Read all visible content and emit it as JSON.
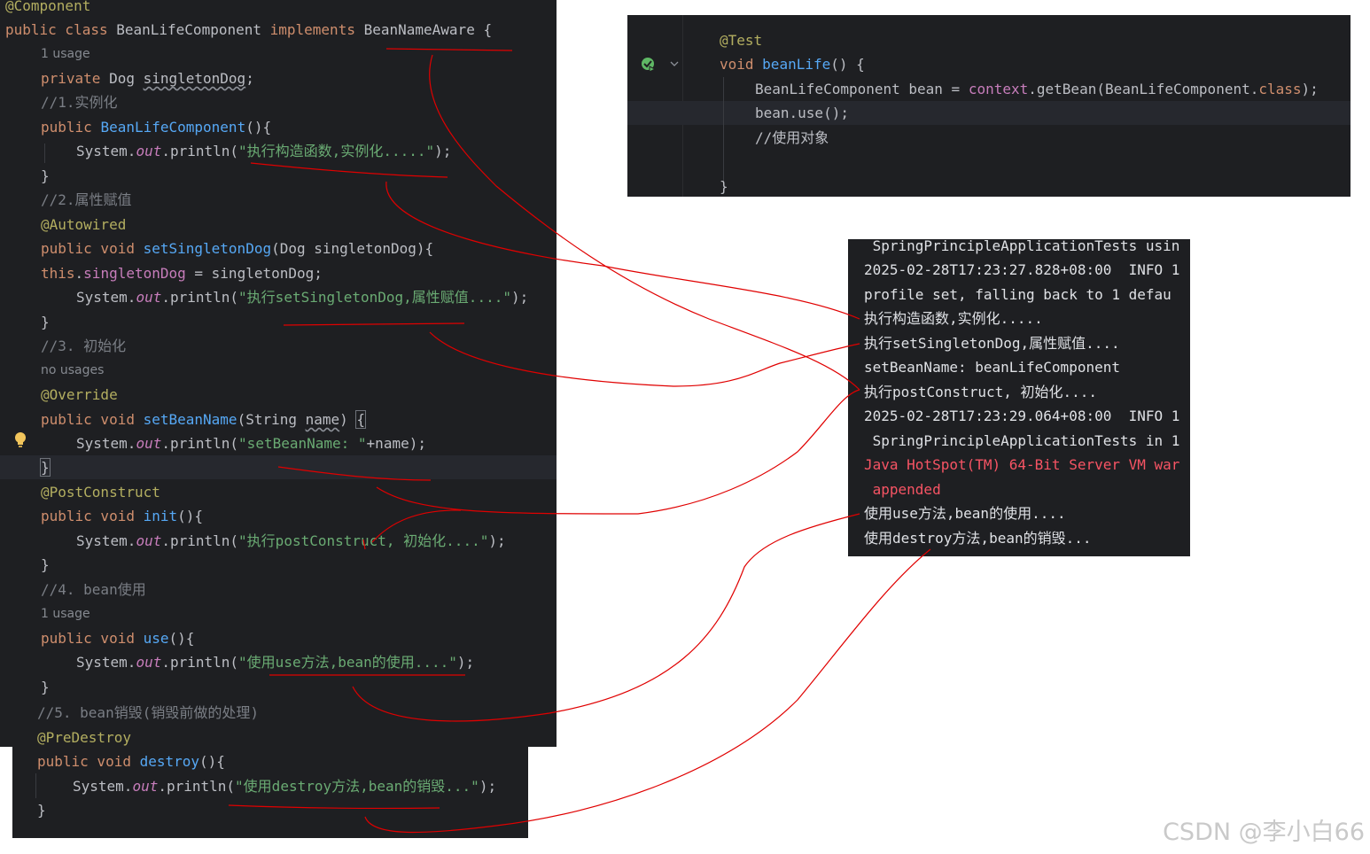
{
  "editor": {
    "line01": {
      "ann": "@Component"
    },
    "line02": {
      "kw1": "public class ",
      "name": "BeanLifeComponent ",
      "kw2": "implements ",
      "iface": "BeanNameAware",
      "rest": " {"
    },
    "line03": {
      "hint": "1 usage"
    },
    "line04": {
      "kw": "private ",
      "type": "Dog ",
      "field": "singletonDog",
      "rest": ";"
    },
    "line05": {
      "comment": "//1.实例化"
    },
    "line06": {
      "kw": "public ",
      "fn": "BeanLifeComponent",
      "rest": "(){"
    },
    "line07": {
      "a": "System.",
      "out": "out",
      "b": ".println(",
      "str": "\"执行构造函数,实例化.....\"",
      "c": ");"
    },
    "line08": {
      "text": "}"
    },
    "line09": {
      "comment": "//2.属性赋值"
    },
    "line10": {
      "ann": "@Autowired"
    },
    "line11": {
      "kw": "public void ",
      "fn": "setSingletonDog",
      "rest": "(Dog singletonDog){"
    },
    "line12": {
      "kw": "this",
      "dot": ".",
      "field": "singletonDog",
      "rest": " = singletonDog;"
    },
    "line13": {
      "a": "System.",
      "out": "out",
      "b": ".println(",
      "str": "\"执行setSingletonDog,属性赋值....\"",
      "c": ");"
    },
    "line14": {
      "text": "}"
    },
    "line15": {
      "comment": "//3. 初始化"
    },
    "line16": {
      "hint": "no usages"
    },
    "line17": {
      "ann": "@Override"
    },
    "line18": {
      "kw": "public void ",
      "fn": "setBeanName",
      "a": "(String ",
      "param": "name",
      "b": ") ",
      "brace": "{"
    },
    "line19": {
      "a": "System.",
      "out": "out",
      "b": ".println(",
      "str": "\"setBeanName: \"",
      "c": "+name);"
    },
    "line20": {
      "text": "}"
    },
    "line21": {
      "ann": "@PostConstruct"
    },
    "line22": {
      "kw": "public void ",
      "fn": "init",
      "rest": "(){"
    },
    "line23": {
      "a": "System.",
      "out": "out",
      "b": ".println(",
      "str": "\"执行postConstruct, 初始化....\"",
      "c": ");"
    },
    "line24": {
      "text": "}"
    },
    "line25": {
      "comment": "//4. bean使用"
    },
    "line26": {
      "hint": "1 usage"
    },
    "line27": {
      "kw": "public void ",
      "fn": "use",
      "rest": "(){"
    },
    "line28": {
      "a": "System.",
      "out": "out",
      "b": ".println(",
      "str": "\"使用use方法,bean的使用....\"",
      "c": ");"
    },
    "line29": {
      "text": "}"
    },
    "line30": {
      "comment": "//5. bean销毁(销毁前做的处理)"
    },
    "line31": {
      "ann": "@PreDestroy"
    },
    "line32": {
      "kw": "public void ",
      "fn": "destroy",
      "rest": "(){"
    },
    "line33": {
      "a": "System.",
      "out": "out",
      "b": ".println(",
      "str": "\"使用destroy方法,bean的销毁...\"",
      "c": ");"
    },
    "line34": {
      "text": "}"
    }
  },
  "test_panel": {
    "l1": {
      "ann": "@Test"
    },
    "l2": {
      "kw": "void ",
      "fn": "beanLife",
      "rest": "() {"
    },
    "l3": {
      "a": "BeanLifeComponent bean = ",
      "ctx": "context",
      "b": ".getBean(BeanLifeComponent.",
      "kw": "class",
      "c": ");"
    },
    "l4": {
      "text": "bean.use();"
    },
    "l5": {
      "comment": "//使用对象"
    },
    "l6": {
      "text": "}"
    }
  },
  "console": {
    "lines": [
      " SpringPrincipleApplicationTests usin",
      "2025-02-28T17:23:27.828+08:00  INFO 1",
      "profile set, falling back to 1 defau",
      "执行构造函数,实例化.....",
      "执行setSingletonDog,属性赋值....",
      "setBeanName: beanLifeComponent",
      "执行postConstruct, 初始化....",
      "2025-02-28T17:23:29.064+08:00  INFO 1",
      " SpringPrincipleApplicationTests in 1",
      "Java HotSpot(TM) 64-Bit Server VM war",
      " appended",
      "使用use方法,bean的使用....",
      "使用destroy方法,bean的销毁..."
    ]
  },
  "colors": {
    "editor_bg": "#1e1f22",
    "keyword": "#cf8e6d",
    "annotation": "#b3ae60",
    "function": "#56a8f5",
    "string": "#6aab73",
    "field": "#c77dbb",
    "comment": "#7a7e85",
    "error": "#f75464",
    "annotation_line": "#e00000"
  },
  "icons": {
    "run": "run-test-icon",
    "bulb": "lightbulb-icon"
  },
  "watermark": "CSDN @李小白66"
}
